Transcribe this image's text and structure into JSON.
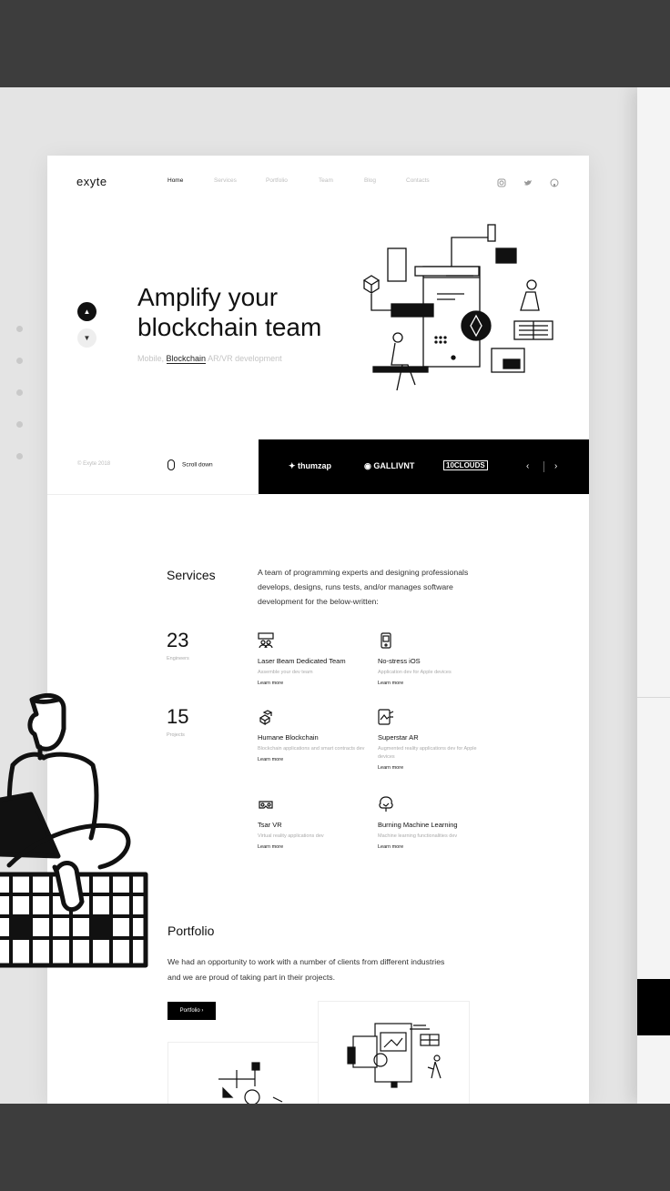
{
  "logo": "exyte",
  "nav": [
    "Home",
    "Services",
    "Portfolio",
    "Team",
    "Blog",
    "Contacts"
  ],
  "nav_active": 0,
  "social_icons": [
    "instagram-icon",
    "twitter-icon",
    "github-icon"
  ],
  "hero": {
    "title_line1": "Amplify your",
    "title_line2": "blockchain team",
    "sub_prefix": "Mobile,",
    "sub_link": "Blockchain",
    "sub_suffix": "AR/VR development"
  },
  "copyright": "© Exyte 2018",
  "scroll_label": "Scroll down",
  "clients": [
    "thumzap",
    "GALLIVNT",
    "10CLOUDS"
  ],
  "services": {
    "heading": "Services",
    "intro": "A team of programming experts and designing professionals develops, designs, runs tests, and/or manages software development for the below-written:",
    "stats": [
      {
        "value": "23",
        "label": "Engineers"
      },
      {
        "value": "15",
        "label": "Projects"
      }
    ],
    "items": [
      {
        "title": "Laser Beam Dedicated Team",
        "desc": "Assemble your dev team",
        "link": "Learn more",
        "icon": "team-icon"
      },
      {
        "title": "No-stress iOS",
        "desc": "Application dev for Apple devices",
        "link": "Learn more",
        "icon": "phone-icon"
      },
      {
        "title": "Humane Blockchain",
        "desc": "Blockchain applications and smart contracts dev",
        "link": "Learn more",
        "icon": "blockchain-icon"
      },
      {
        "title": "Superstar AR",
        "desc": "Augmented reality applications dev for Apple devices",
        "link": "Learn more",
        "icon": "ar-icon"
      },
      {
        "title": "Tsar VR",
        "desc": "Virtual reality applications dev",
        "link": "Learn more",
        "icon": "vr-icon"
      },
      {
        "title": "Burning Machine Learning",
        "desc": "Machine learning functionalities dev",
        "link": "Learn more",
        "icon": "ml-icon"
      }
    ]
  },
  "portfolio": {
    "heading": "Portfolio",
    "text": "We had an opportunity to work with a number of clients from different industries and we are proud of taking part in their projects.",
    "button": "Portfolio"
  }
}
